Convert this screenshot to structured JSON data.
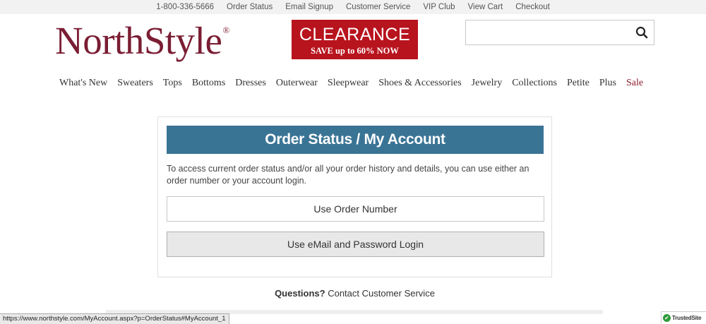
{
  "topbar": {
    "links": [
      "1-800-336-5666",
      "Order Status",
      "Email Signup",
      "Customer Service",
      "VIP Club",
      "View Cart",
      "Checkout"
    ]
  },
  "logo": {
    "text": "NorthStyle",
    "mark": "®"
  },
  "clearance": {
    "title": "CLEARANCE",
    "subtitle": "SAVE up to 60% NOW"
  },
  "search": {
    "value": "",
    "placeholder": "",
    "icon": "search-icon"
  },
  "nav": {
    "items": [
      "What's New",
      "Sweaters",
      "Tops",
      "Bottoms",
      "Dresses",
      "Outerwear",
      "Sleepwear",
      "Shoes & Accessories",
      "Jewelry",
      "Collections",
      "Petite",
      "Plus",
      "Sale"
    ],
    "sale_color": "#8b1a2b"
  },
  "panel": {
    "title": "Order Status / My Account",
    "description": "To access current order status and/or all your order history and details, you can use either an order number or your account login.",
    "order_button": "Use Order Number",
    "email_button": "Use eMail and Password Login"
  },
  "questions": {
    "bold": "Questions?",
    "link": "Contact Customer Service"
  },
  "statusbar": {
    "url": "https://www.northstyle.com/MyAccount.aspx?p=OrderStatus#MyAccount_1"
  },
  "trusted": {
    "label": "TrustedSite"
  },
  "colors": {
    "brand": "#7a1d33",
    "clearance_bg": "#b8141e",
    "header_bg": "#3a7495"
  }
}
